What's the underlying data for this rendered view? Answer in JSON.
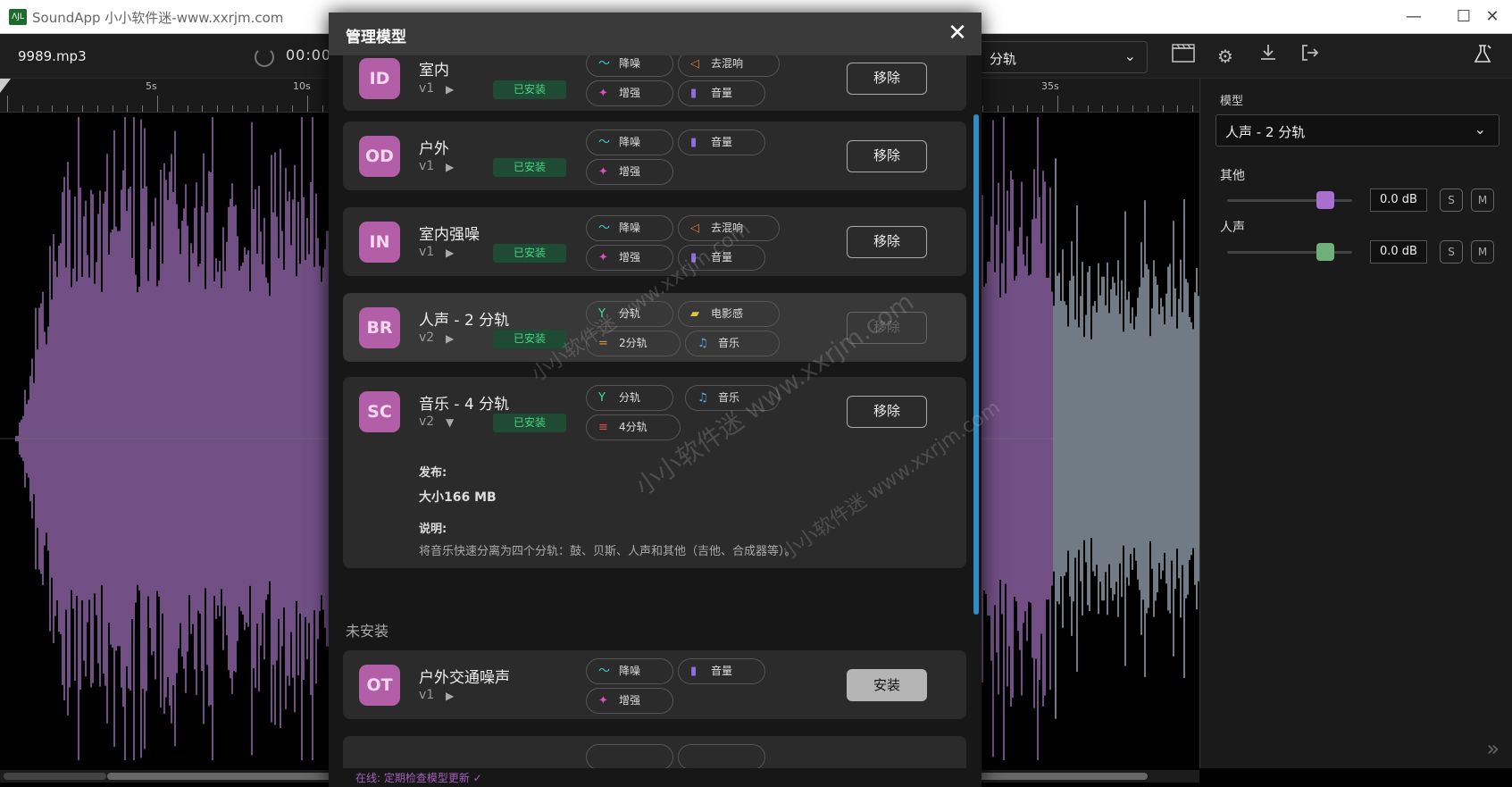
{
  "window": {
    "title": "SoundApp 小小软件迷-www.xxrjm.com",
    "logo": "ɅJL"
  },
  "toolbar": {
    "filename": "9989.mp3",
    "time": "00:00",
    "model_select": "分轨"
  },
  "ruler": {
    "labels": [
      "5s",
      "10s",
      "35s"
    ]
  },
  "right_panel": {
    "model_label": "模型",
    "model_value": "人声 - 2 分轨",
    "stems": [
      {
        "name": "其他",
        "db": "0.0 dB",
        "solo": "S",
        "mute": "M",
        "color": "#a86fcf"
      },
      {
        "name": "人声",
        "db": "0.0 dB",
        "solo": "S",
        "mute": "M",
        "color": "#6fb07a"
      }
    ]
  },
  "modal": {
    "title": "管理模型",
    "close_label": "✕",
    "installed_badge": "已安装",
    "remove_label": "移除",
    "install_label": "安装",
    "models": [
      {
        "code": "ID",
        "name": "室内",
        "version": "v1",
        "tags": [
          "降噪",
          "去混响",
          "增强",
          "音量"
        ]
      },
      {
        "code": "OD",
        "name": "户外",
        "version": "v1",
        "tags": [
          "降噪",
          "音量",
          "增强"
        ]
      },
      {
        "code": "IN",
        "name": "室内强噪",
        "version": "v1",
        "tags": [
          "降噪",
          "去混响",
          "增强",
          "音量"
        ]
      },
      {
        "code": "BR",
        "name": "人声 - 2 分轨",
        "version": "v2",
        "tags": [
          "分轨",
          "电影感",
          "2分轨",
          "音乐"
        ]
      },
      {
        "code": "SC",
        "name": "音乐 - 4 分轨",
        "version": "v2",
        "tags": [
          "分轨",
          "音乐",
          "4分轨"
        ]
      }
    ],
    "details": {
      "release_label": "发布:",
      "size": "大小166 MB",
      "desc_label": "说明:",
      "desc": "将音乐快速分离为四个分轨：鼓、贝斯、人声和其他（吉他、合成器等）。"
    },
    "uninstalled_title": "未安装",
    "uninstalled": [
      {
        "code": "OT",
        "name": "户外交通噪声",
        "version": "v1",
        "tags": [
          "降噪",
          "音量",
          "增强"
        ]
      }
    ],
    "footer_status": "在线: 定期检查模型更新 ✓"
  },
  "watermark": [
    "小小软件迷 www.xxrjm.com",
    "小小软件迷 www.xxrjm.com",
    "小小软件迷 www.xxrjm.com"
  ],
  "colors": {
    "waveform_left": "#8e63a6",
    "waveform_right": "#8d9aa8",
    "accent": "#b25fa8",
    "installed": "#48d481"
  }
}
